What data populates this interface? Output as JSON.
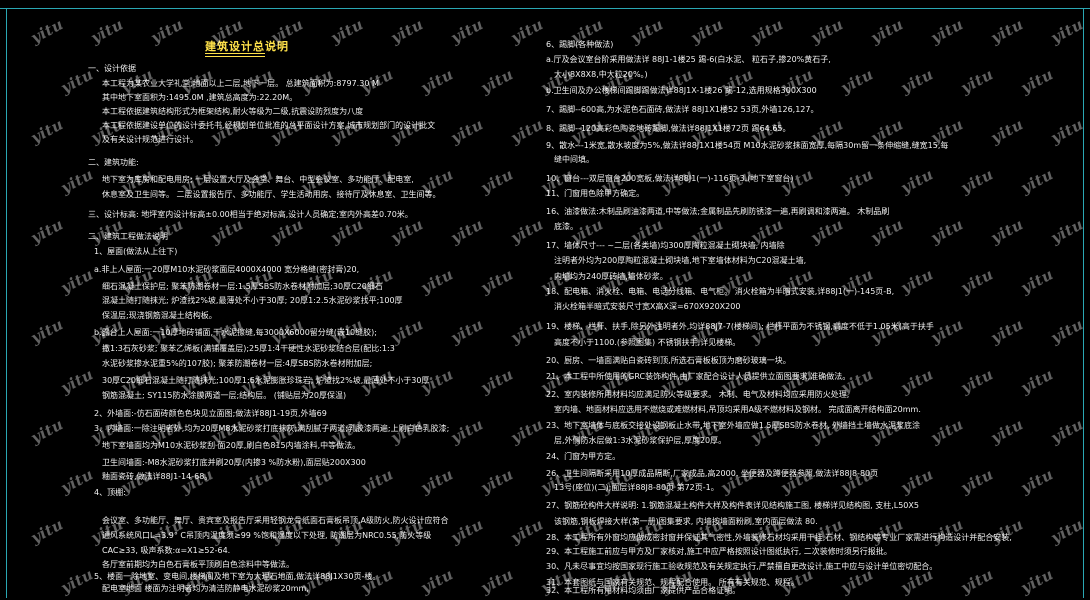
{
  "doc_title": "建筑设计总说明",
  "watermark": "yitu",
  "colors": {
    "frame": "#2aa7b3",
    "title": "#ffe24a",
    "text": "#f2f2f2",
    "background": "#000000"
  },
  "left_lines": [
    "一、设计依据",
    "本工程为某农业大学礼堂,地面以上二层,地下一层。              总建筑面积为:8797.30  M",
    "其中地下室面积为:1495.0M ,建筑总高度为:22.20M。",
    "本工程依据建筑结构形式为框架结构,耐火等级为二级,抗震设防烈度为八度",
    "本工程依据建设单位的设计委托书,经规划单位批准的总平面设计方案,城市规划部门的设计批文",
    "及有关设计规范进行设计。",
    "二、建筑功能:",
    "地下室为库房和配电用房;      一层设置大厅及会堂、舞台、中型会议室、多功能厅、配电室,",
    "休息室及卫生间等。        二层设置报告厅、多功能厅、学生活动用房、接待厅及休息室、卫生间等。",
    "三、设计标高:    地坪室内设计标高±0.00相当于绝对标高,设计人员确定;室内外高差0.70米。",
    "二、建筑工程做法说明",
    "1、屋面(做法从上往下)",
    "a.非上人屋面:一20厚M10水泥砂浆面层4000X4000                         宽分格缝(密封膏)20,",
    "细石混凝土保护层;   聚苯防潮卷材一层:1.5厚SBS防水卷材附加层;30厚C20细石",
    "混凝土随打随抹光;  炉渣找2%坡,最薄处不小于30厚;  20厚1:2.5水泥砂浆找平;100厚",
    "保温层;现浇钢筋混凝土结构板。",
    "b.露台上人屋面:一10厚地砖铺面,干水泥擦缝,每3000X6000留分缝(嵌10缝胶);",
    "撒1:3石灰砂浆;  聚苯乙烯板(满铺覆盖层);25厚1:4干硬性水泥砂浆结合层(配比:1:3",
    "水泥砂浆掺水泥重5%的107胶); 聚苯防潮卷材一层:4厚SBS防水卷材附加层;",
    "30厚C20细石混凝土随打随抹光;100厚1:6水泥膨胀珍珠岩;        炉渣找2%坡,最薄处不小于30厚",
    "钢筋混凝土;  SY115防水涂膜两道一层;结构层。                    (铺贴层为20厚保温)",
    "2、外墙面:-仿石面砖颜色色块见立面图;做法详88J1-19页,外墙69",
    "3、内墙面:一除注明者外,均为20厚M8水泥砂浆打底抹灰;满刮腻子两道;乳胶漆两遍;上刷白色乳胶漆;",
    "           地下室墙面均为M10水泥砂浆刮                   面20厚,刷白色815内墙涂料,中等做法。",
    "卫生间墙面:-M8水泥砂浆打底并刷20厚(内掺3                     %防水粉),面层贴200X300",
    "           釉面瓷砖,做法详88J1-14-68。",
    "4、顶棚:",
    "会议室、多功能厅、舞厅、贵宾室及报告厅采用轻钢龙骨纸面石膏板吊顶,A级防火,防火设计应符合",
    "通风系统风口L=3.9° C吊顶内温度须≥99        %饱和湿度以下处理,       防潮层为NRC0.55,防火等级",
    "CAC≥33,  吸声系数:α=X1≥52-64.",
    "各厅室前期均为白色石膏板平顶刷白色涂料中等做法。",
    "5、楼面一除地室、变电间,楼梯间及地下室为大理石地面,做法详88J1X30页-楼。",
    "       配电室地面 楼面为注明者均为清洁防静电水泥砂浆20mm,"
  ],
  "right_lines": [
    "6、踢脚(各种做法)",
    "a.厅及会议室台阶采用做法详 88J1-1楼25 踢-6(白水泥、                        粒石子,掺20%黄石子,",
    "大小8X8X8,中大粒20%。)",
    "b.卫生间及办公楼梯间踢脚踢做法详88J1X-1楼26 踢-12,选用规格300X300",
    "7、踢脚--600高,为水泥色石面砖,做法详 88J1X1楼52 53页,外墙126,127。",
    "8、踢脚--120高彩色陶瓷地砖踢脚,做法详88J1X1楼72页 踢64.65。",
    "9、散水---1米宽,散水坡度为5%,做法详88J1X1楼54页 M10水泥砂浆抹面宽厚,每隔30m留一条伸缩缝,缝宽15,每",
    "        缝中间填。",
    "10、窗台---双层窗台200宽板,做法详88J1(一)-116页-3.(地下室窗台)",
    "11、门窗用色除甲方确定。",
    "16、油漆做法:木制品刷油漆两道,中等做法;金属制品先刷防锈漆一遍,再刷调和漆两遍。  木制品刷",
    "           底漆。",
    "17、墙体尺寸---  ~二层(各类墙)均300厚陶粒混凝土砌块墙,  内墙除",
    "    注明者外均为200厚陶粒混凝土砌块墙,地下室墙体材料为C20混凝土墙,",
    "    内墙均为240厚砖墙,墙体砂浆。",
    "18、配电箱、消火栓、电箱、电话分线箱、电气柜。         消火栓箱为半暗式安装,详88J1(一)-145页-B,",
    "    消火栓箱半暗式安装尺寸宽X高X深=670X920X200",
    "19、楼梯、栏杆、扶手,除另外注明者外,均详88J7-7(楼梯间);  栏杆平面为不锈钢,高度不低于1.05米(高于扶手",
    "    高度不小于1100.(参照图集)                       不锈钢扶手,详见楼梯。",
    "20、厨房、一墙面满贴白瓷砖到顶,所选石膏板板顶为磨砂玻璃一块。",
    "21、本工程中所使用的GRC装饰构件,由厂家配合设计人员提供立面图要求,准确做法。",
    "22、室内装修所用材料均应满足防火等级要求。                  木制、电气及材料均应采用防火处理,",
    "           室内墙、地面材料应选用不燃烧或难燃材料,吊顶均采用A级不燃材料及钢材。          完成面离开结构面20mm.",
    "23、地下室墙体与底板交接处设钢板止水带,地下室外墙应做1.5厚SBS防水卷材,  外墙挡土墙做水泥浆底涂",
    "    层,外侧防水层做1:3水泥砂浆保护层,厚度20厚。",
    "24、门窗为甲方定。",
    "26、卫生间隔断采用10厚成品隔断,厂家成品,高2000.   坐便器及蹲便器参照,做法详88J8-80页",
    "    13号(座位)(二);面层详88J8-80页 第72页-1。",
    "27、钢筋砼构件大样说明:      1.钢筋混凝土构件大样及构件表详见结构施工图,    楼梯详见结构图,         支柱,L50X5",
    "    该钢筋,钢板焊接大样(第一册)图集要求,       内墙按墙面粉刷,室内面层做法  80.",
    "28、本工程所有外窗均应做成密封窗并保证其气密性,外墙装修石材均采用干挂,石材、钢结构等专业厂家需进行构造设计并配合安装,",
    "29、本工程施工前应与甲方及厂家核对,施工中应严格按照设计图纸执行,     二次装修时须另行报批。",
    "30、凡未尽事宜均按国家现行施工验收规范及有关规定执行,严禁擅自更改设计,施工中应与设计单位密切配合。",
    "31、本套图纸与国家有关规范、规程配合使用。              所有有关规范、规程。",
    "32、本工程所有用材料均须由厂家提供产品合格证明。"
  ]
}
